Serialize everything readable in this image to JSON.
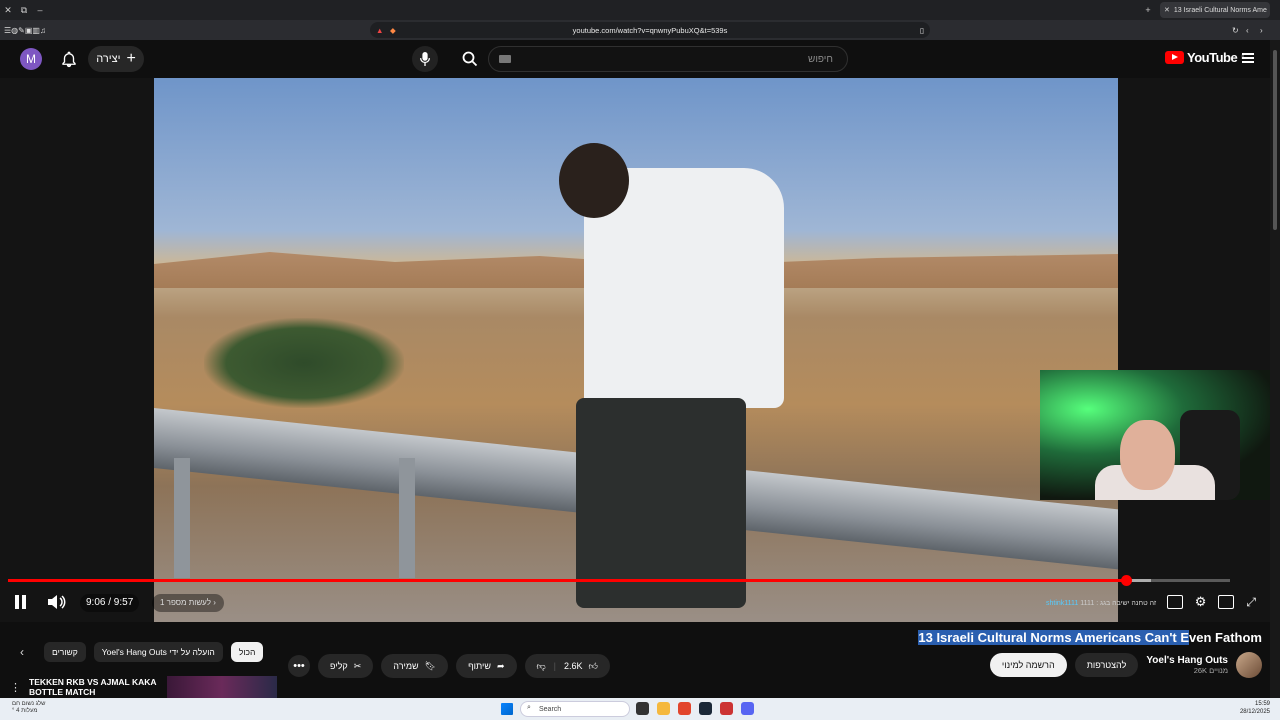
{
  "browser": {
    "tab_title": "13 Israeli Cultural Norms Ame",
    "url": "youtube.com/watch?v=qnwnyPubuXQ&t=539s"
  },
  "header": {
    "avatar_letter": "M",
    "create_label": "יצירה",
    "search_placeholder": "חיפוש",
    "logo_text": "YouTube",
    "logo_region": "IL"
  },
  "player": {
    "time_display": "9:06 / 9:57",
    "chapter_label": "1 לעשות מספר",
    "progress_fraction": 0.915,
    "buffer_fraction": 0.935,
    "chat_name": "shtink1111",
    "chat_text": "1111 : זה טחנה ישיבה בגג",
    "accent_color": "#ff0000"
  },
  "video": {
    "title_highlight": "13 Israeli Cultural Norms Americans Can't E",
    "title_rest": "ven Fathom",
    "channel_name": "Yoel's Hang Outs",
    "channel_subs": "26K מנויים",
    "subscribe_label": "להצטרפות",
    "join_label": "הרשמה למינוי"
  },
  "actions": {
    "like_count": "2.6K",
    "share_label": "שיתוף",
    "save_label": "שמירה",
    "clip_label": "קליפ",
    "more_label": "•••"
  },
  "chips": {
    "all_label": "הכול",
    "uploader_label": "Yoel's Hang Outs הועלה על ידי",
    "related_label": "קשורים"
  },
  "recommendation": {
    "title_line1": "TEKKEN RKB VS AJMAL KAKA",
    "title_line2": "BOTTLE MATCH"
  },
  "taskbar": {
    "weather_line1": "שלג נשום חם",
    "weather_line2": "° 4 מעלות",
    "search_label": "Search",
    "time": "15:59",
    "date": "28/12/2025"
  }
}
